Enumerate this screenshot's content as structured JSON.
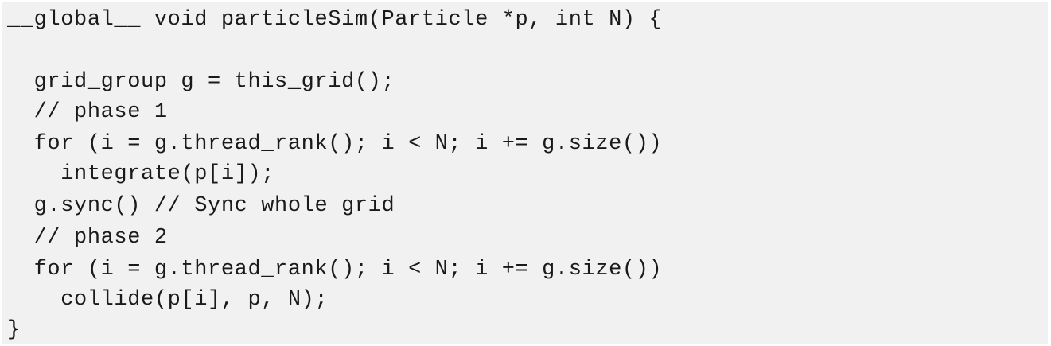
{
  "code": {
    "lines": [
      "__global__ void particleSim(Particle *p, int N) {",
      "",
      "  grid_group g = this_grid();",
      "  // phase 1",
      "  for (i = g.thread_rank(); i < N; i += g.size())",
      "    integrate(p[i]);",
      "  g.sync() // Sync whole grid",
      "  // phase 2",
      "  for (i = g.thread_rank(); i < N; i += g.size())",
      "    collide(p[i], p, N);",
      "}"
    ]
  }
}
